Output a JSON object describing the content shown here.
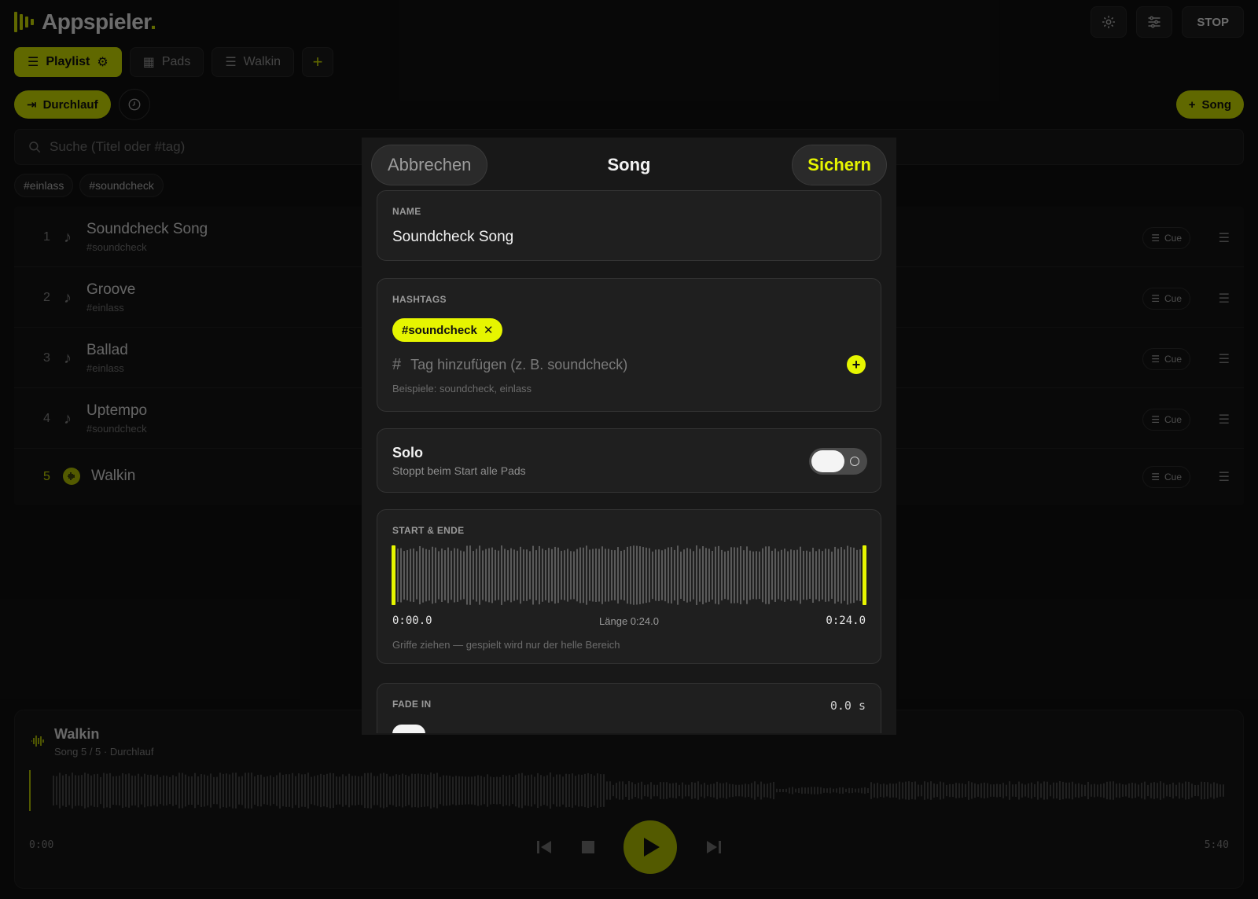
{
  "app": {
    "name": "Appspieler",
    "stop_label": "STOP"
  },
  "tabs": [
    {
      "label": "Playlist"
    },
    {
      "label": "Pads"
    },
    {
      "label": "Walkin"
    }
  ],
  "toolbar": {
    "run_mode_label": "Durchlauf",
    "add_song_label": "Song"
  },
  "search": {
    "placeholder": "Suche (Titel oder #tag)"
  },
  "tag_filters": [
    "#einlass",
    "#soundcheck"
  ],
  "songs": [
    {
      "num": "1",
      "title": "Soundcheck Song",
      "tag": "#soundcheck",
      "cue": "Cue"
    },
    {
      "num": "2",
      "title": "Groove",
      "tag": "#einlass",
      "cue": "Cue"
    },
    {
      "num": "3",
      "title": "Ballad",
      "tag": "#einlass",
      "cue": "Cue"
    },
    {
      "num": "4",
      "title": "Uptempo",
      "tag": "#soundcheck",
      "cue": "Cue"
    },
    {
      "num": "5",
      "title": "Walkin",
      "tag": "",
      "cue": "Cue"
    }
  ],
  "player": {
    "title": "Walkin",
    "subtitle": "Song 5 / 5 · Durchlauf",
    "time_current": "0:00",
    "time_total": "5:40",
    "progress": 0.0
  },
  "modal": {
    "cancel_label": "Abbrechen",
    "title": "Song",
    "save_label": "Sichern",
    "name_label": "NAME",
    "name_value": "Soundcheck Song",
    "hashtags_label": "HASHTAGS",
    "hashtag_chip": "#soundcheck",
    "hashtag_placeholder": "Tag hinzufügen (z. B. soundcheck)",
    "hashtag_hint": "Beispiele: soundcheck, einlass",
    "solo_title": "Solo",
    "solo_sub": "Stoppt beim Start alle Pads",
    "solo_on": false,
    "range_label": "START & ENDE",
    "range_start": "0:00.0",
    "range_length": "Länge 0:24.0",
    "range_end": "0:24.0",
    "range_hint": "Griffe ziehen — gespielt wird nur der helle Bereich",
    "fade_in_label": "FADE IN",
    "fade_in_value": "0.0 s"
  },
  "colors": {
    "accent": "#e6f500",
    "accent_dim": "#d4e600",
    "background": "#111111",
    "card": "#1f1f1f"
  }
}
